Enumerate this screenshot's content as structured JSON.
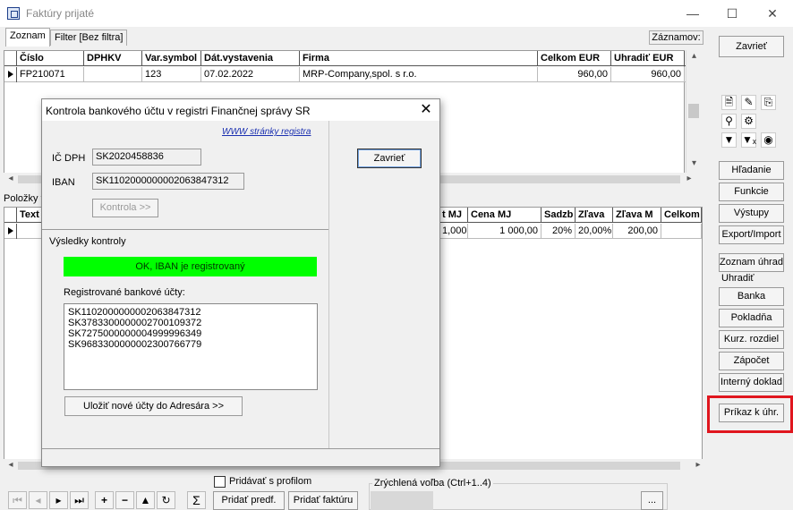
{
  "window": {
    "title": "Faktúry prijaté",
    "minimize": "—",
    "maximize": "☐",
    "close": "✕"
  },
  "tabs": [
    {
      "label": "Zoznam"
    },
    {
      "label": "Filter [Bez filtra]"
    }
  ],
  "zaznamov_label": "Záznamov:",
  "invoice_grid": {
    "columns": [
      "Číslo",
      "DPHKV",
      "Var.symbol",
      "Dát.vystavenia",
      "Firma",
      "Celkom EUR",
      "Uhradiť EUR"
    ],
    "rows": [
      {
        "cislo": "FP210071",
        "dphkv": "",
        "var_symbol": "123",
        "datum": "07.02.2022",
        "firma": "MRP-Company,spol. s r.o.",
        "celkom": "960,00",
        "uhradit": "960,00"
      }
    ]
  },
  "items_label": "Položky f",
  "items_grid": {
    "columns": [
      "Text",
      "t MJ",
      "Cena MJ",
      "Sadzb",
      "Zľava",
      "Zľava M",
      "Celkom"
    ],
    "rows": [
      {
        "text": "",
        "mj": "1,000",
        "cena": "1 000,00",
        "sadzba": "20%",
        "zlava": "20,00%",
        "zlava_m": "200,00",
        "celkom": ""
      }
    ]
  },
  "side_panel": {
    "close": "Zavrieť",
    "icons": [
      "document-icon",
      "edit-document-icon",
      "copy-document-icon",
      "search-icon",
      "gear-icon",
      "filter-icon",
      "filter-clear-icon",
      "eye-icon"
    ],
    "buttons": [
      "Hľadanie",
      "Funkcie",
      "Výstupy",
      "Export/Import"
    ],
    "zoznam_uhrad": "Zoznam úhrad",
    "uhradit_group": "Uhradiť",
    "uhradit_buttons": [
      "Banka",
      "Pokladňa",
      "Kurz. rozdiel",
      "Zápočet",
      "Interný doklad"
    ],
    "prikaz": "Príkaz k úhr."
  },
  "bottom": {
    "pridavat_profil": "Pridávať s profilom",
    "sum_symbol": "Σ",
    "pridat_predf": "Pridať predf.",
    "pridat_fakturu": "Pridať faktúru",
    "zrychlena_volba": "Zrýchlená voľba (Ctrl+1..4)",
    "more": "..."
  },
  "dialog": {
    "title": "Kontrola bankového účtu v registri Finančnej správy SR",
    "link": "WWW stránky registra",
    "ic_dph_label": "IČ DPH",
    "ic_dph_value": "SK2020458836",
    "iban_label": "IBAN",
    "iban_value": "SK1102000000002063847312",
    "kontrola_btn": "Kontrola >>",
    "close_btn": "Zavrieť",
    "results_label": "Výsledky kontroly",
    "result_status": "OK, IBAN je registrovaný",
    "status_color": "#00ff00",
    "registered_label": "Registrované bankové účty:",
    "accounts": [
      "SK1102000000002063847312",
      "SK3783300000002700109372",
      "SK7275000000004999996349",
      "SK9683300000002300766779"
    ],
    "save_btn": "Uložiť nové účty do Adresára >>"
  }
}
